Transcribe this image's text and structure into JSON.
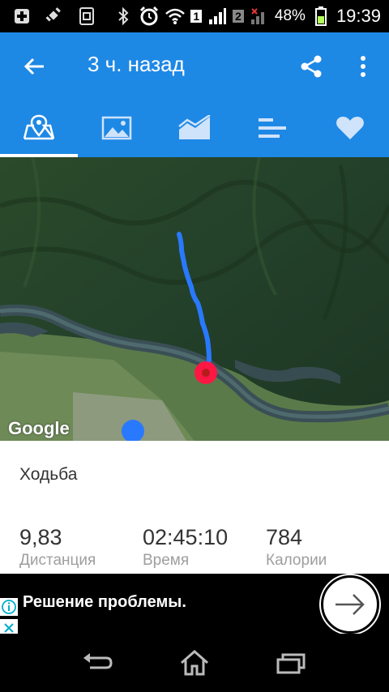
{
  "status_bar": {
    "battery_percent": "48%",
    "time": "19:39",
    "sim1_label": "1",
    "sim2_label": "2"
  },
  "app_bar": {
    "title": "3 ч. назад",
    "color": "#1e88e5"
  },
  "tabs": [
    {
      "icon": "map-icon",
      "active": true
    },
    {
      "icon": "image-icon",
      "active": false
    },
    {
      "icon": "chart-icon",
      "active": false
    },
    {
      "icon": "list-icon",
      "active": false
    },
    {
      "icon": "heart-icon",
      "active": false
    }
  ],
  "map": {
    "logo": "Google",
    "route_color": "#2979ff",
    "start_marker_color": "#ff1744",
    "location_marker_color": "#2979ff"
  },
  "workout": {
    "activity": "Ходьба",
    "stats": [
      {
        "value": "9,83",
        "label": "Дистанция"
      },
      {
        "value": "02:45:10",
        "label": "Время"
      },
      {
        "value": "784",
        "label": "Калории"
      }
    ]
  },
  "ad": {
    "text": "Решение проблемы."
  }
}
